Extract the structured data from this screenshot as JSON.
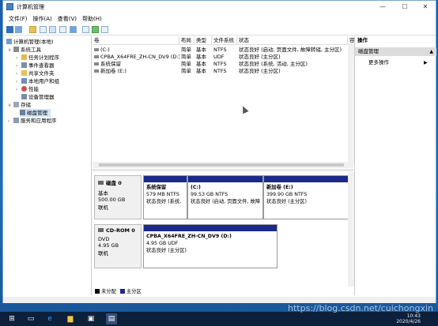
{
  "window": {
    "title": "计算机管理",
    "min": "—",
    "max": "☐",
    "close": "✕"
  },
  "menu": [
    "文件(F)",
    "操作(A)",
    "查看(V)",
    "帮助(H)"
  ],
  "toolbar": [
    "back-arrow-icon",
    "forward-arrow-icon",
    "up-folder-icon",
    "properties-icon",
    "help-icon",
    "show-hide-tree-icon",
    "refresh-icon",
    "new-icon",
    "check-icon",
    "search-icon"
  ],
  "tree": {
    "root": "计算机管理(本地)",
    "system_tools": "系统工具",
    "task_scheduler": "任务计划程序",
    "event_viewer": "事件查看器",
    "shared_folders": "共享文件夹",
    "local_users": "本地用户和组",
    "performance": "性能",
    "device_manager": "设备管理器",
    "storage": "存储",
    "disk_management": "磁盘管理",
    "services": "服务和应用程序"
  },
  "volumes": {
    "headers": [
      "卷",
      "布局",
      "类型",
      "文件系统",
      "状态",
      "容"
    ],
    "rows": [
      [
        "(C:)",
        "简单",
        "基本",
        "NTFS",
        "状态良好 (启动, 页面文件, 故障转储, 主分区)",
        "9"
      ],
      [
        "CPBA_X64FRE_ZH-CN_DV9 (D:)",
        "简单",
        "基本",
        "UDF",
        "状态良好 (主分区)",
        "4"
      ],
      [
        "系统保留",
        "简单",
        "基本",
        "NTFS",
        "状态良好 (系统, 活动, 主分区)",
        "5"
      ],
      [
        "新加卷 (E:)",
        "简单",
        "基本",
        "NTFS",
        "状态良好 (主分区)",
        "3"
      ]
    ]
  },
  "disks": [
    {
      "name": "磁盘 0",
      "type": "基本",
      "size": "500.00 GB",
      "status": "联机",
      "partitions": [
        {
          "name": "系统保留",
          "size": "579 MB NTFS",
          "status": "状态良好 (系统,"
        },
        {
          "name": "(C:)",
          "size": "99.53 GB NTFS",
          "status": "状态良好 (启动, 页面文件, 故障"
        },
        {
          "name": "新加卷 (E:)",
          "size": "399.90 GB NTFS",
          "status": "状态良好 (主分区)"
        }
      ]
    },
    {
      "name": "CD-ROM 0",
      "type": "DVD",
      "size": "4.95 GB",
      "status": "联机",
      "partitions": [
        {
          "name": "CPBA_X64FRE_ZH-CN_DV9 (D:)",
          "size": "4.95 GB UDF",
          "status": "状态良好 (主分区)"
        }
      ]
    }
  ],
  "legend": {
    "unallocated": "未分配",
    "primary": "主分区",
    "unallocated_color": "#000000",
    "primary_color": "#1b2a8a"
  },
  "actions": {
    "header": "操作",
    "section": "磁盘管理",
    "more": "更多操作"
  },
  "taskbar": {
    "time": "10:43",
    "date": "2020/4/26"
  },
  "watermark": "https://blog.csdn.net/cuichongxin"
}
